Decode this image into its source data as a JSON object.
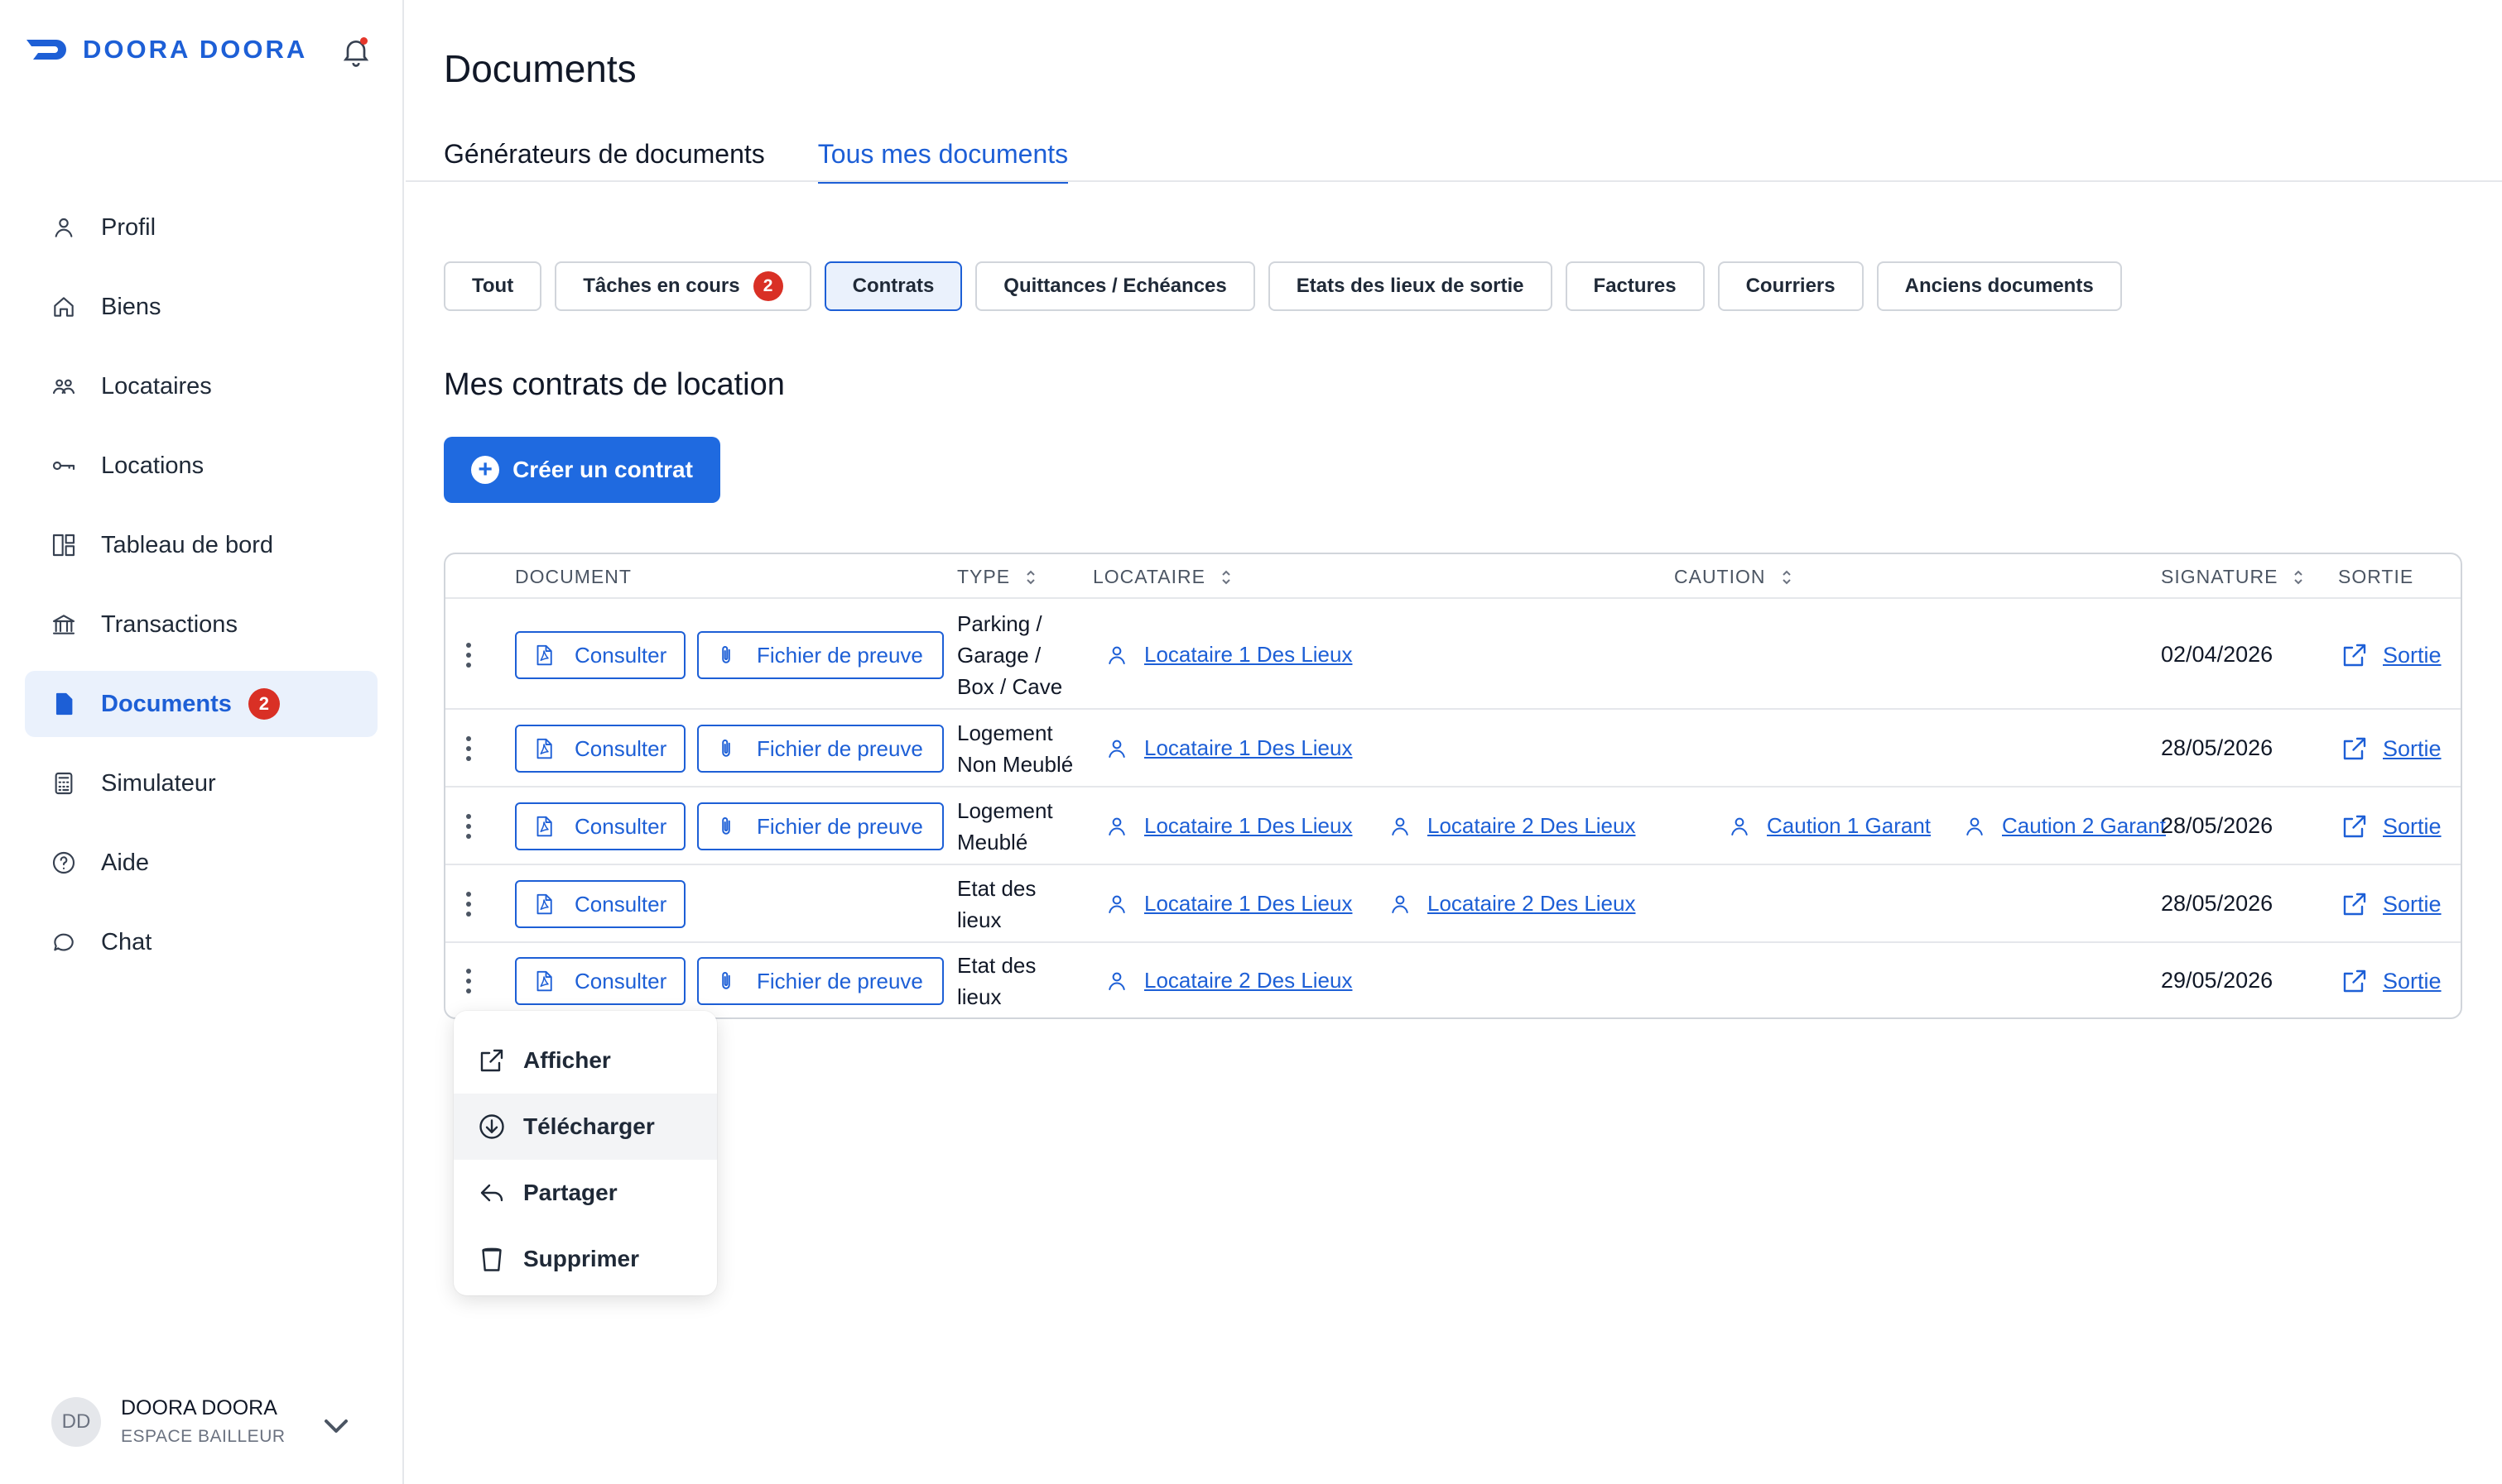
{
  "brand": {
    "name": "DOORA DOORA",
    "color": "#1d5fd6"
  },
  "sidebar": {
    "items": [
      {
        "label": "Profil",
        "icon": "user-icon"
      },
      {
        "label": "Biens",
        "icon": "home-icon"
      },
      {
        "label": "Locataires",
        "icon": "users-icon"
      },
      {
        "label": "Locations",
        "icon": "key-icon"
      },
      {
        "label": "Tableau de bord",
        "icon": "dashboard-icon"
      },
      {
        "label": "Transactions",
        "icon": "bank-icon"
      },
      {
        "label": "Documents",
        "icon": "document-icon",
        "badge": "2",
        "active": true
      },
      {
        "label": "Simulateur",
        "icon": "calculator-icon"
      },
      {
        "label": "Aide",
        "icon": "help-icon"
      },
      {
        "label": "Chat",
        "icon": "chat-icon"
      }
    ],
    "user": {
      "initials": "DD",
      "name": "DOORA DOORA",
      "role": "ESPACE BAILLEUR"
    }
  },
  "page": {
    "title": "Documents",
    "tabs": [
      {
        "label": "Générateurs de documents",
        "active": false
      },
      {
        "label": "Tous mes documents",
        "active": true
      }
    ]
  },
  "filters": [
    {
      "label": "Tout"
    },
    {
      "label": "Tâches en cours",
      "badge": "2"
    },
    {
      "label": "Contrats",
      "active": true
    },
    {
      "label": "Quittances / Echéances"
    },
    {
      "label": "Etats des lieux de sortie"
    },
    {
      "label": "Factures"
    },
    {
      "label": "Courriers"
    },
    {
      "label": "Anciens documents"
    }
  ],
  "section": {
    "title": "Mes contrats de location",
    "create_label": "Créer un contrat"
  },
  "table": {
    "headers": {
      "document": "DOCUMENT",
      "type": "TYPE",
      "locataire": "LOCATAIRE",
      "caution": "CAUTION",
      "signature": "SIGNATURE",
      "sortie": "SORTIE"
    },
    "consult_label": "Consulter",
    "proof_label": "Fichier de preuve",
    "sortie_label": "Sortie",
    "rows": [
      {
        "type_lines": [
          "Parking /",
          "Garage /",
          "Box / Cave"
        ],
        "proof": true,
        "people": [
          "Locataire 1 Des Lieux"
        ],
        "date": "02/04/2026"
      },
      {
        "type_lines": [
          "Logement",
          "Non Meublé"
        ],
        "proof": true,
        "people": [
          "Locataire 1 Des Lieux"
        ],
        "date": "28/05/2026"
      },
      {
        "type_lines": [
          "Logement",
          "Meublé"
        ],
        "proof": true,
        "people": [
          "Locataire 1 Des Lieux",
          "Locataire 2 Des Lieux",
          "Caution 1 Garant",
          "Caution 2 Garant"
        ],
        "date": "28/05/2026"
      },
      {
        "type_lines": [
          "Etat des",
          "lieux"
        ],
        "proof": false,
        "people": [
          "Locataire 1 Des Lieux",
          "Locataire 2 Des Lieux"
        ],
        "date": "28/05/2026"
      },
      {
        "type_lines": [
          "Etat des",
          "lieux"
        ],
        "proof": true,
        "people": [
          "Locataire 2 Des Lieux"
        ],
        "date": "29/05/2026"
      }
    ]
  },
  "menu": {
    "items": [
      {
        "label": "Afficher",
        "icon": "external-link-icon"
      },
      {
        "label": "Télécharger",
        "icon": "download-icon",
        "hover": true
      },
      {
        "label": "Partager",
        "icon": "share-icon"
      },
      {
        "label": "Supprimer",
        "icon": "trash-icon"
      }
    ]
  }
}
